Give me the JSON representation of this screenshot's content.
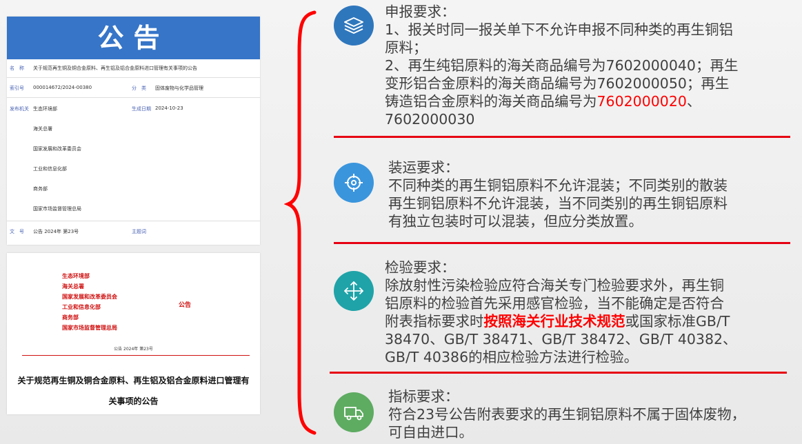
{
  "document": {
    "banner": "公告",
    "rows": [
      {
        "k1": "名　称",
        "v1": "关于规范再生铜及铜合金原料、再生铝及铝合金原料进口管理有关事项的公告"
      },
      {
        "k1": "索引号",
        "v1": "000014672/2024-00380",
        "k2": "分　类",
        "v2": "固体废物与化学品管理"
      },
      {
        "k1": "发布机关",
        "v1": "生态环境部",
        "k2": "生成日期",
        "v2": "2024-10-23"
      },
      {
        "v1": "海关总署"
      },
      {
        "v1": "国家发展和改革委员会"
      },
      {
        "v1": "工业和信息化部"
      },
      {
        "v1": "商务部"
      },
      {
        "v1": "国家市场监督管理总局"
      },
      {
        "k1": "文　号",
        "v1": "公告 2024年 第23号",
        "k2": "主题词",
        "v2": ""
      }
    ],
    "issuers": [
      "生态环境部",
      "海关总署",
      "国家发展和改革委员会",
      "工业和信息化部",
      "商务部",
      "国家市场监督管理总局"
    ],
    "gonggao": "公告",
    "doc_number": "公告 2024年 第23号",
    "title_line1": "关于规范再生铜及铜合金原料、再生铝及铝合金原料进口管理有",
    "title_line2": "关事项的公告"
  },
  "sections": [
    {
      "icon": "stack-layers-icon",
      "color": "#2f77bd",
      "title": "申报要求：",
      "lines": [
        "1、报关时同一报关单下不允许申报不同种类的再生铜铝",
        "原料；",
        "2、再生纯铝原料的海关商品编号为7602000040；再生",
        "变形铝合金原料的海关商品编号为7602000050；再生"
      ],
      "line5_pre": "铸造铝合金原料的海关商品编号为",
      "line5_red": "7602000020",
      "line5_post": "、",
      "line6": "7602000030"
    },
    {
      "icon": "crosshair-icon",
      "color": "#3a95dd",
      "title": "装运要求：",
      "lines": [
        "不同种类的再生铜铝原料不允许混装；不同类别的散装",
        "再生铜铝原料不允许混装，当不同类别的再生铜铝原料",
        "有独立包装时可以混装，但应分类放置。"
      ]
    },
    {
      "icon": "move-arrows-icon",
      "color": "#1fa3a8",
      "title": "检验要求：",
      "lines": [
        "除放射性污染检验应符合海关专门检验要求外，再生铜",
        "铝原料的检验首先采用感官检验，当不能确定是否符合"
      ],
      "line3_pre": "附表指标要求时",
      "line3_red": "按照海关行业技术规范",
      "line3_post": "或国家标准GB/T",
      "lines_after": [
        "38470、GB/T 38471、GB/T 38472、GB/T 40382、",
        "GB/T 40386的相应检验方法进行检验。"
      ]
    },
    {
      "icon": "truck-icon",
      "color": "#5eab62",
      "title": "指标要求：",
      "lines": [
        "符合23号公告附表要求的再生铜铝原料不属于固体废物，",
        "可自由进口。"
      ]
    }
  ]
}
